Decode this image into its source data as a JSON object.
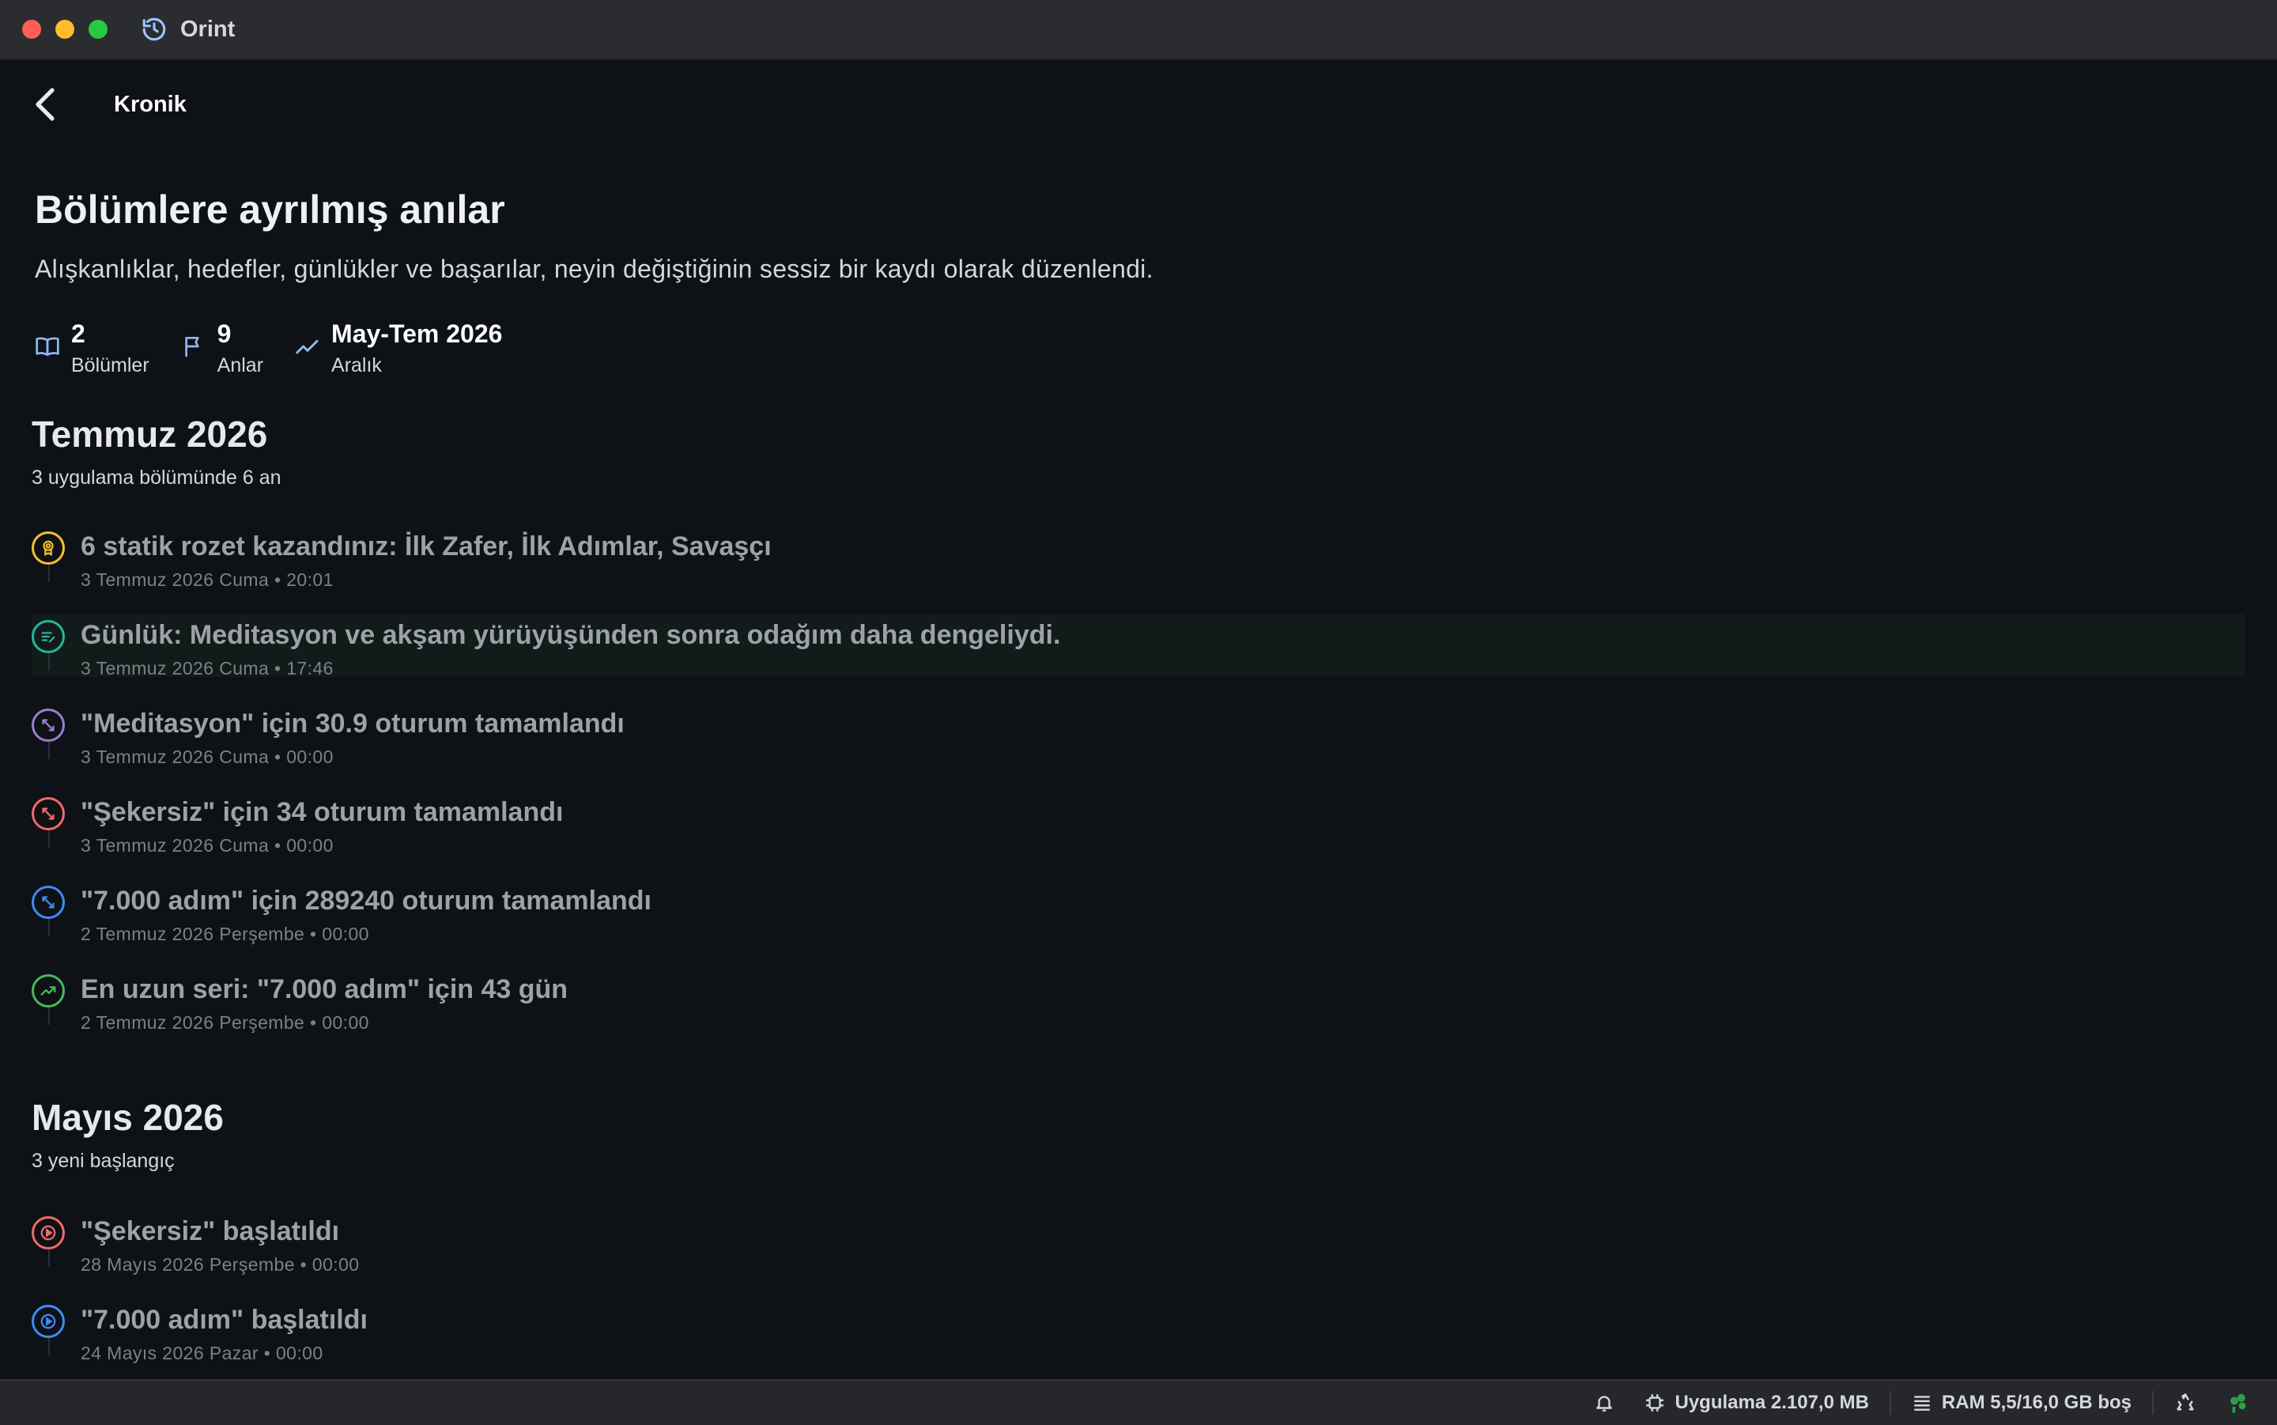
{
  "app": {
    "title": "Orint"
  },
  "nav": {
    "title": "Kronik"
  },
  "hero": {
    "title": "Bölümlere ayrılmış anılar",
    "subtitle": "Alışkanlıklar, hedefler, günlükler ve başarılar, neyin değiştiğinin sessiz bir kaydı olarak düzenlendi."
  },
  "stats": [
    {
      "value": "2",
      "label": "Bölümler",
      "icon": "book-icon"
    },
    {
      "value": "9",
      "label": "Anlar",
      "icon": "flag-icon"
    },
    {
      "value": "May-Tem 2026",
      "label": "Aralık",
      "icon": "trend-icon"
    }
  ],
  "sections": [
    {
      "title": "Temmuz 2026",
      "subtitle": "3 uygulama bölümünde 6 an",
      "items": [
        {
          "text": "6 statik rozet kazandınız: İlk Zafer, İlk Adımlar, Savaşçı",
          "meta": "3 Temmuz 2026 Cuma • 20:01",
          "color": "#f2c12e",
          "icon": "badge-icon"
        },
        {
          "text": "Günlük: Meditasyon ve akşam yürüyüşünden sonra odağım daha dengeliydi.",
          "meta": "3 Temmuz 2026 Cuma • 17:46",
          "color": "#26b5a0",
          "icon": "journal-icon"
        },
        {
          "text": "\"Meditasyon\" için 30.9 oturum tamamlandı",
          "meta": "3 Temmuz 2026 Cuma • 00:00",
          "color": "#9c7cd0",
          "icon": "expand-icon"
        },
        {
          "text": "\"Şekersiz\" için 34 oturum tamamlandı",
          "meta": "3 Temmuz 2026 Cuma • 00:00",
          "color": "#f06a6a",
          "icon": "expand-icon"
        },
        {
          "text": "\"7.000 adım\" için 289240 oturum tamamlandı",
          "meta": "2 Temmuz 2026 Perşembe • 00:00",
          "color": "#3d8bf5",
          "icon": "expand-icon"
        },
        {
          "text": "En uzun seri: \"7.000 adım\" için 43 gün",
          "meta": "2 Temmuz 2026 Perşembe • 00:00",
          "color": "#46b85a",
          "icon": "trend-icon"
        }
      ]
    },
    {
      "title": "Mayıs 2026",
      "subtitle": "3 yeni başlangıç",
      "items": [
        {
          "text": "\"Şekersiz\" başlatıldı",
          "meta": "28 Mayıs 2026 Perşembe • 00:00",
          "color": "#f06a6a",
          "icon": "play-icon"
        },
        {
          "text": "\"7.000 adım\" başlatıldı",
          "meta": "24 Mayıs 2026 Pazar • 00:00",
          "color": "#3d8bf5",
          "icon": "play-icon"
        }
      ]
    }
  ],
  "statusbar": {
    "app_memory": "Uygulama 2.107,0 MB",
    "ram": "RAM 5,5/16,0 GB boş"
  }
}
